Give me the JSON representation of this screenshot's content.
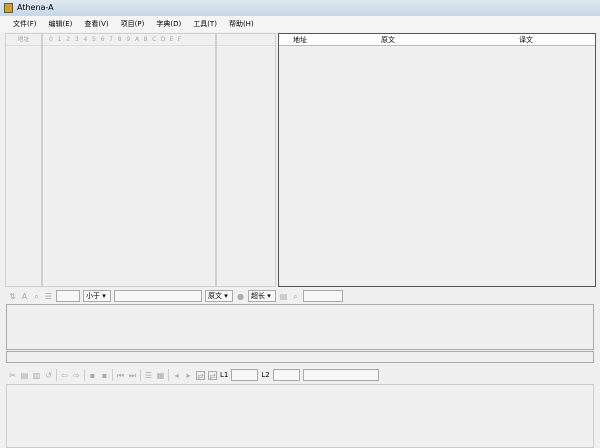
{
  "window": {
    "title": "Athena-A"
  },
  "menu": [
    "文件(F)",
    "编辑(E)",
    "查看(V)",
    "项目(P)",
    "字典(D)",
    "工具(T)",
    "帮助(H)"
  ],
  "hex_view": {
    "address_header": "地址",
    "columns": [
      "0",
      "1",
      "2",
      "3",
      "4",
      "5",
      "6",
      "7",
      "8",
      "9",
      "A",
      "B",
      "C",
      "D",
      "E",
      "F"
    ]
  },
  "table": {
    "headers": [
      "地址",
      "原文",
      "译文"
    ]
  },
  "search_toolbar": {
    "compare_select": "小于",
    "source_select": "原文",
    "length_select": "超长"
  },
  "edit_toolbar": {
    "l1_label": "L1",
    "l2_label": "L2"
  }
}
